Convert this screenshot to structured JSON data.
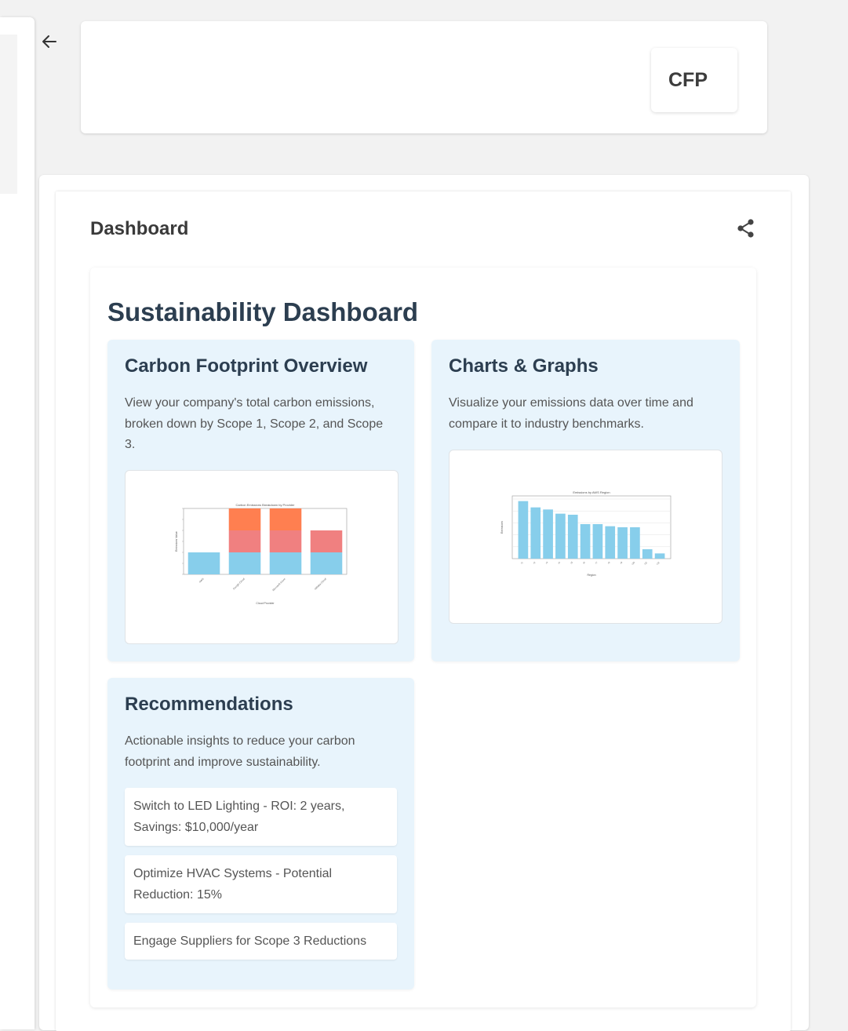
{
  "header": {
    "badge_text": "CFP"
  },
  "dashboard": {
    "label": "Dashboard",
    "title": "Sustainability Dashboard"
  },
  "panels": {
    "overview": {
      "title": "Carbon Footprint Overview",
      "description": "View your company's total carbon emissions, broken down by Scope 1, Scope 2, and Scope 3."
    },
    "charts": {
      "title": "Charts & Graphs",
      "description": "Visualize your emissions data over time and compare it to industry benchmarks."
    },
    "recommendations": {
      "title": "Recommendations",
      "description": "Actionable insights to reduce your carbon footprint and improve sustainability.",
      "items": [
        "Switch to LED Lighting - ROI: 2 years, Savings: $10,000/year",
        "Optimize HVAC Systems - Potential Reduction: 15%",
        "Engage Suppliers for Scope 3 Reductions"
      ]
    }
  },
  "chart_data": [
    {
      "type": "bar",
      "title": "Carbon Emissions Breakdown by Provider",
      "xlabel": "Cloud Provider",
      "ylabel": "Emissions Value",
      "categories": [
        "AWS",
        "Google Cloud",
        "Microsoft Azure",
        "Alibaba Cloud"
      ],
      "series": [
        {
          "values": [
            1.0,
            1.0,
            1.0,
            1.0
          ],
          "color": "#87ceeb"
        },
        {
          "values": [
            0,
            1.0,
            1.0,
            1.0
          ],
          "color": "#f08080"
        },
        {
          "values": [
            0,
            1.0,
            1.0,
            0
          ],
          "color": "#ff7f50"
        }
      ],
      "ylim": [
        0,
        3.0
      ]
    },
    {
      "type": "bar",
      "title": "Emissions by AWS Region",
      "xlabel": "Region",
      "ylabel": "Emissions",
      "categories": [
        "r1",
        "r2",
        "r3",
        "r4",
        "r5",
        "r6",
        "r7",
        "r8",
        "r9",
        "r10",
        "r11",
        "r12"
      ],
      "values": [
        0.55,
        0.49,
        0.47,
        0.43,
        0.42,
        0.33,
        0.33,
        0.31,
        0.3,
        0.3,
        0.09,
        0.05
      ],
      "color": "#87ceeb",
      "ylim": [
        0,
        0.6
      ]
    }
  ]
}
